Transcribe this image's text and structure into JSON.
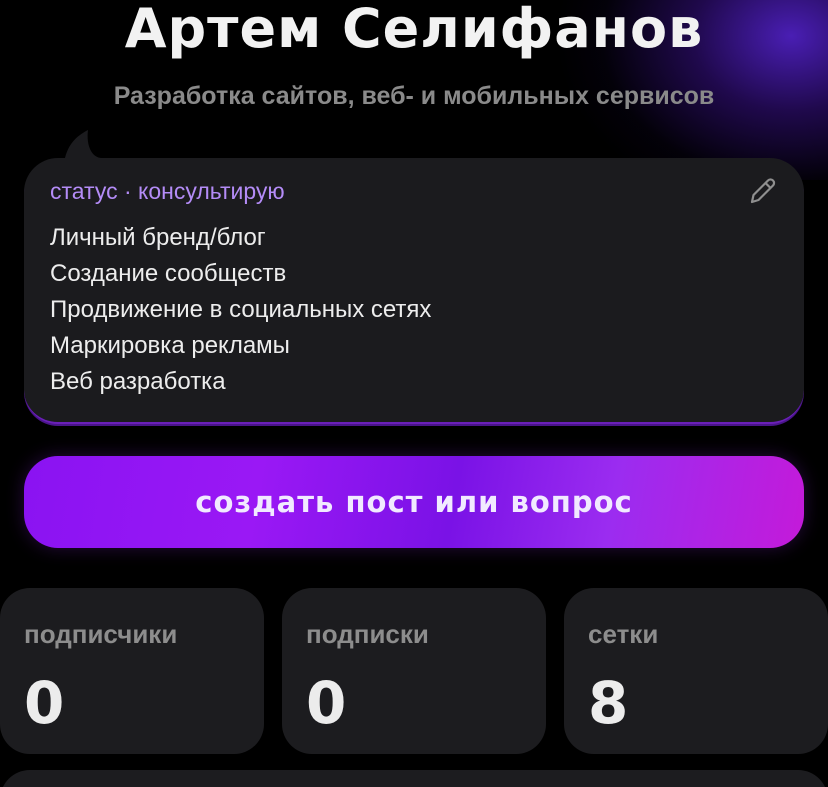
{
  "profile": {
    "name": "Артем Селифанов",
    "subtitle": "Разработка сайтов, веб- и мобильных сервисов"
  },
  "status": {
    "label": "статус · консультирую",
    "edit_icon": "pencil-icon",
    "lines": [
      "Личный бренд/блог",
      "Создание сообществ",
      "Продвижение в социальных сетях",
      "Маркировка рекламы",
      "Веб разработка"
    ]
  },
  "actions": {
    "create_label": "создать пост или вопрос"
  },
  "stats": [
    {
      "label": "подписчики",
      "value": "0"
    },
    {
      "label": "подписки",
      "value": "0"
    },
    {
      "label": "сетки",
      "value": "8"
    }
  ],
  "colors": {
    "background": "#000000",
    "card": "#1c1c1f",
    "accent_purple": "#8a13f2",
    "status_label": "#b48cf7",
    "muted_text": "#8d8d8d"
  }
}
